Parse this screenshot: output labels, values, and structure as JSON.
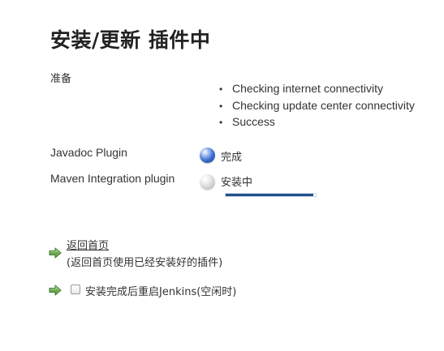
{
  "page": {
    "title": "安装/更新 插件中"
  },
  "preparation": {
    "label": "准备",
    "checks": [
      "Checking internet connectivity",
      "Checking update center connectivity",
      "Success"
    ]
  },
  "plugins": [
    {
      "name": "Javadoc Plugin",
      "status": "完成",
      "icon": "blue-ball-icon"
    },
    {
      "name": "Maven Integration plugin",
      "status": "安装中",
      "icon": "grey-ball-icon",
      "progress": 0.97
    }
  ],
  "actions": {
    "back_link": "返回首页",
    "back_description": "(返回首页使用已经安装好的插件)",
    "restart_label": "安装完成后重启Jenkins(空闲时)",
    "restart_checked": false,
    "arrow_icon": "green-arrow-icon"
  },
  "colors": {
    "progress_fill": "#1f4f8a",
    "arrow_green": "#6aa84f",
    "link_text": "#333333"
  }
}
